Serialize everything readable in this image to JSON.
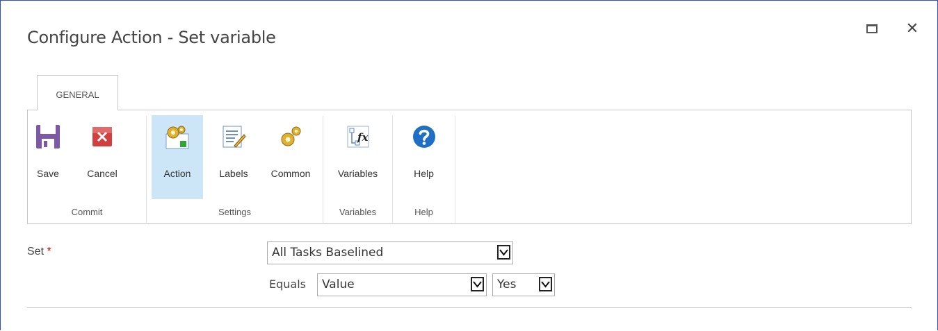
{
  "dialog": {
    "title": "Configure Action - Set variable",
    "window_controls": {
      "maximize_icon": "maximize-icon",
      "close_icon": "close-icon",
      "close_glyph": "✕"
    }
  },
  "ribbon": {
    "tabs": [
      {
        "label": "GENERAL",
        "selected": true
      }
    ],
    "groups": [
      {
        "label": "Commit",
        "buttons": [
          {
            "label": "Save",
            "icon": "save-icon"
          },
          {
            "label": "Cancel",
            "icon": "cancel-icon"
          }
        ]
      },
      {
        "label": "Settings",
        "buttons": [
          {
            "label": "Action",
            "icon": "action-gears-icon",
            "active": true
          },
          {
            "label": "Labels",
            "icon": "labels-pencil-icon"
          },
          {
            "label": "Common",
            "icon": "common-gears-icon"
          }
        ]
      },
      {
        "label": "Variables",
        "buttons": [
          {
            "label": "Variables",
            "icon": "variables-fx-icon"
          }
        ]
      },
      {
        "label": "Help",
        "buttons": [
          {
            "label": "Help",
            "icon": "help-icon"
          }
        ]
      }
    ]
  },
  "form": {
    "set": {
      "label": "Set",
      "required_marker": "*",
      "value": "All Tasks Baselined"
    },
    "equals": {
      "label": "Equals",
      "type_value": "Value",
      "value": "Yes"
    }
  },
  "colors": {
    "accent": "#2f4ec3",
    "active_button": "#cde6f7",
    "required": "#bf0000",
    "border": "#c6c6c6"
  }
}
